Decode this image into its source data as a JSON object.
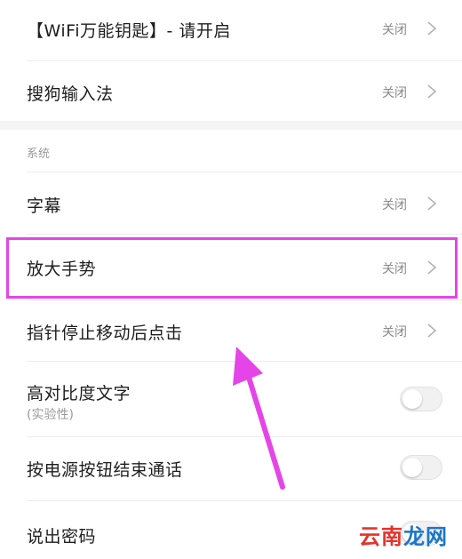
{
  "settings": {
    "rows": [
      {
        "label": "【WiFi万能钥匙】- 请开启",
        "value": "关闭"
      },
      {
        "label": "搜狗输入法",
        "value": "关闭"
      }
    ],
    "system_header": "系统",
    "system_rows": [
      {
        "label": "字幕",
        "value": "关闭"
      },
      {
        "label": "放大手势",
        "value": "关闭",
        "highlighted": true
      },
      {
        "label": "指针停止移动后点击",
        "value": "关闭"
      }
    ],
    "toggle_rows": [
      {
        "label": "高对比度文字",
        "sublabel": "(实验性)",
        "on": false
      },
      {
        "label": "按电源按钮结束通话",
        "on": false
      },
      {
        "label": "说出密码",
        "on": false
      }
    ]
  },
  "annotation": {
    "highlight_color": "#e545e8",
    "arrow_color": "#e545e8"
  },
  "watermark": {
    "part1": "云南",
    "part2": "龙网"
  }
}
